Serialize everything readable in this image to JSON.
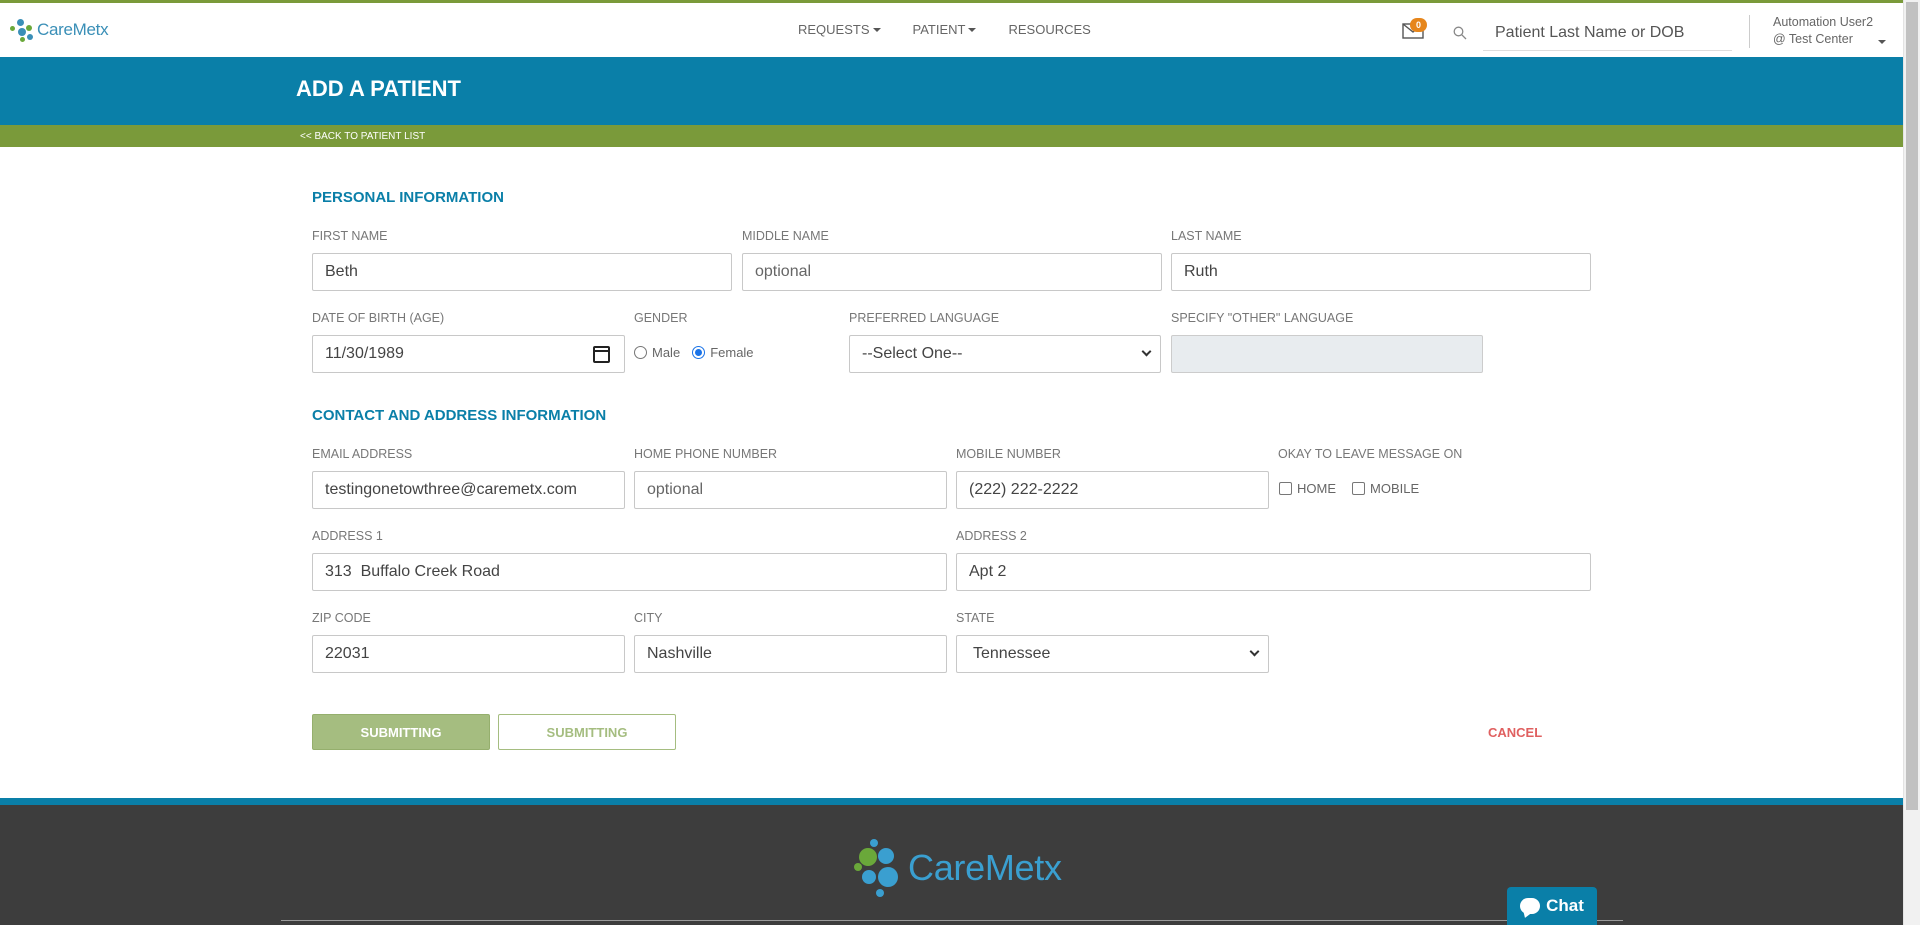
{
  "header": {
    "logo_text": "CareMetx",
    "nav": [
      {
        "label": "REQUESTS"
      },
      {
        "label": "PATIENT"
      },
      {
        "label": "RESOURCES"
      }
    ],
    "notification_count": "0",
    "search_placeholder": "Patient Last Name or DOB",
    "user_name": "Automation User2",
    "user_center": "@ Test Center"
  },
  "banner": {
    "title": "ADD A PATIENT",
    "back_link": "<< BACK TO PATIENT LIST"
  },
  "personal": {
    "section_title": "PERSONAL INFORMATION",
    "first_name_label": "FIRST NAME",
    "first_name_value": "Beth",
    "middle_name_label": "MIDDLE NAME",
    "middle_name_placeholder": "optional",
    "last_name_label": "LAST NAME",
    "last_name_value": "Ruth",
    "dob_label": "DATE OF BIRTH (AGE)",
    "dob_value": "11/30/1989",
    "gender_label": "GENDER",
    "gender_male": "Male",
    "gender_female": "Female",
    "gender_selected": "Female",
    "language_label": "PREFERRED LANGUAGE",
    "language_value": "--Select One--",
    "other_language_label": "SPECIFY \"OTHER\" LANGUAGE",
    "other_language_value": ""
  },
  "contact": {
    "section_title": "CONTACT AND ADDRESS INFORMATION",
    "email_label": "EMAIL ADDRESS",
    "email_value": "testingonetowthree@caremetx.com",
    "home_phone_label": "HOME PHONE NUMBER",
    "home_phone_placeholder": "optional",
    "mobile_label": "MOBILE NUMBER",
    "mobile_value": "(222) 222-2222",
    "leave_msg_label": "OKAY TO LEAVE MESSAGE ON",
    "leave_msg_home": "HOME",
    "leave_msg_mobile": "MOBILE",
    "address1_label": "ADDRESS 1",
    "address1_value": "313  Buffalo Creek Road",
    "address2_label": "ADDRESS 2",
    "address2_value": "Apt 2",
    "zip_label": "ZIP CODE",
    "zip_value": "22031",
    "city_label": "CITY",
    "city_value": "Nashville",
    "state_label": "STATE",
    "state_value": "Tennessee"
  },
  "actions": {
    "submit_label": "SUBMITTING",
    "submit2_label": "SUBMITTING",
    "cancel_label": "CANCEL"
  },
  "footer": {
    "logo_text": "CareMetx",
    "chat_label": "Chat"
  },
  "colors": {
    "brand_blue": "#0a7fa8",
    "brand_green": "#7a9a3a",
    "button_green": "#a5bd80",
    "cancel_red": "#e06060",
    "badge_orange": "#e6861c"
  }
}
